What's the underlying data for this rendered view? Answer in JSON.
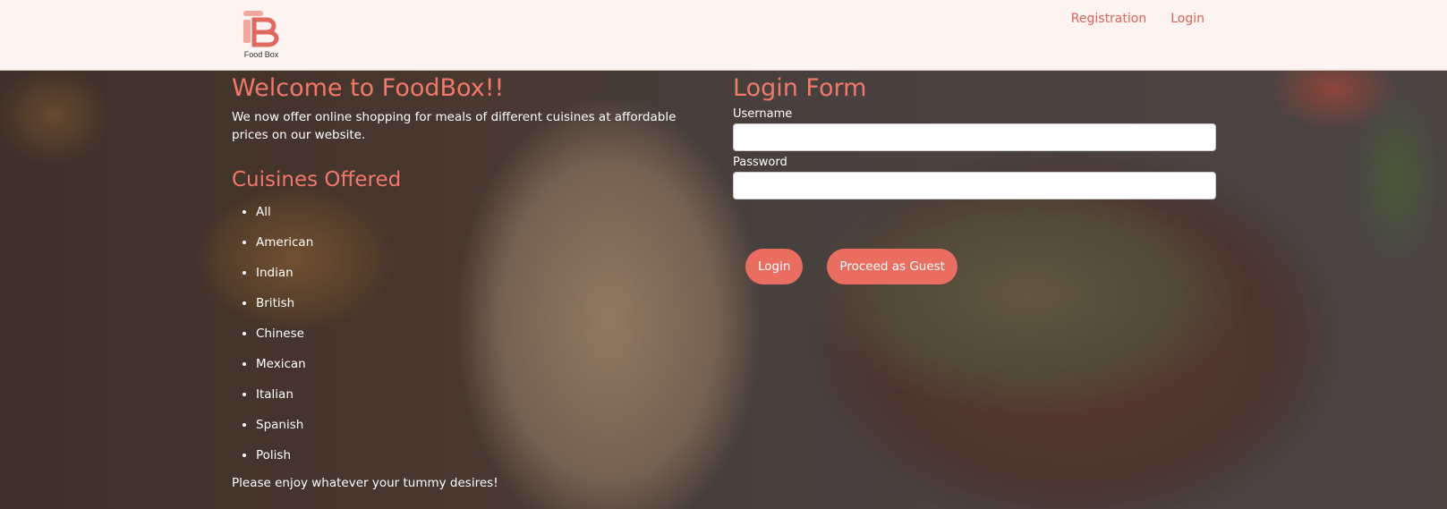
{
  "header": {
    "logo_text": "Food Box",
    "nav": [
      {
        "label": "Registration"
      },
      {
        "label": "Login"
      }
    ]
  },
  "welcome": {
    "title": "Welcome to FoodBox!!",
    "text": "We now offer online shopping for meals of different cuisines at affordable prices on our website."
  },
  "cuisines": {
    "title": "Cuisines Offered",
    "items": [
      "All",
      "American",
      "Indian",
      "British",
      "Chinese",
      "Mexican",
      "Italian",
      "Spanish",
      "Polish"
    ],
    "footer_text": "Please enjoy whatever your tummy desires!"
  },
  "login_form": {
    "title": "Login Form",
    "username_label": "Username",
    "username_value": "",
    "password_label": "Password",
    "password_value": "",
    "login_button": "Login",
    "guest_button": "Proceed as Guest"
  },
  "colors": {
    "accent": "#f2786b",
    "button": "#e96d60",
    "nav_link": "#dc625a",
    "header_bg": "#fdf4f2"
  }
}
